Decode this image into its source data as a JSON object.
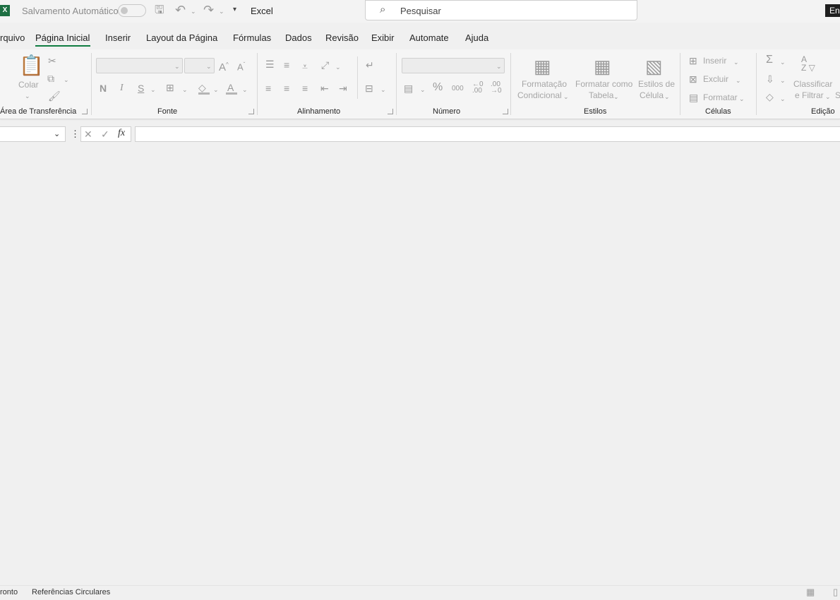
{
  "titlebar": {
    "app_icon_letter": "X",
    "autosave_label": "Salvamento Automático",
    "app_name": "Excel",
    "search_placeholder": "Pesquisar",
    "signin_label": "En"
  },
  "tabs": [
    "rquivo",
    "Página Inicial",
    "Inserir",
    "Layout da Página",
    "Fórmulas",
    "Dados",
    "Revisão",
    "Exibir",
    "Automate",
    "Ajuda"
  ],
  "active_tab": "Página Inicial",
  "ribbon": {
    "clipboard": {
      "paste_label": "Colar",
      "group_label": "Área de Transferência"
    },
    "font": {
      "group_label": "Fonte",
      "bold": "N",
      "italic": "I",
      "underline": "S",
      "font_color": "A",
      "grow": "A^",
      "shrink": "A˅"
    },
    "alignment": {
      "group_label": "Alinhamento"
    },
    "number": {
      "group_label": "Número",
      "percent": "%",
      "thousands": "000"
    },
    "styles": {
      "group_label": "Estilos",
      "conditional_line1": "Formatação",
      "conditional_line2": "Condicional",
      "table_line1": "Formatar como",
      "table_line2": "Tabela",
      "cellstyles_line1": "Estilos de",
      "cellstyles_line2": "Célula"
    },
    "cells": {
      "group_label": "Células",
      "insert": "Inserir",
      "delete": "Excluir",
      "format": "Formatar"
    },
    "editing": {
      "group_label": "Edição",
      "sort_line1": "Classificar",
      "sort_line2": "e Filtrar",
      "find_partial": "S"
    }
  },
  "formula_bar": {
    "name_box": "",
    "fx": "fx",
    "formula": ""
  },
  "status": {
    "ready": "ronto",
    "circular": "Referências Circulares"
  },
  "colors": {
    "accent": "#107c41",
    "excel_green": "#1d6f42"
  }
}
